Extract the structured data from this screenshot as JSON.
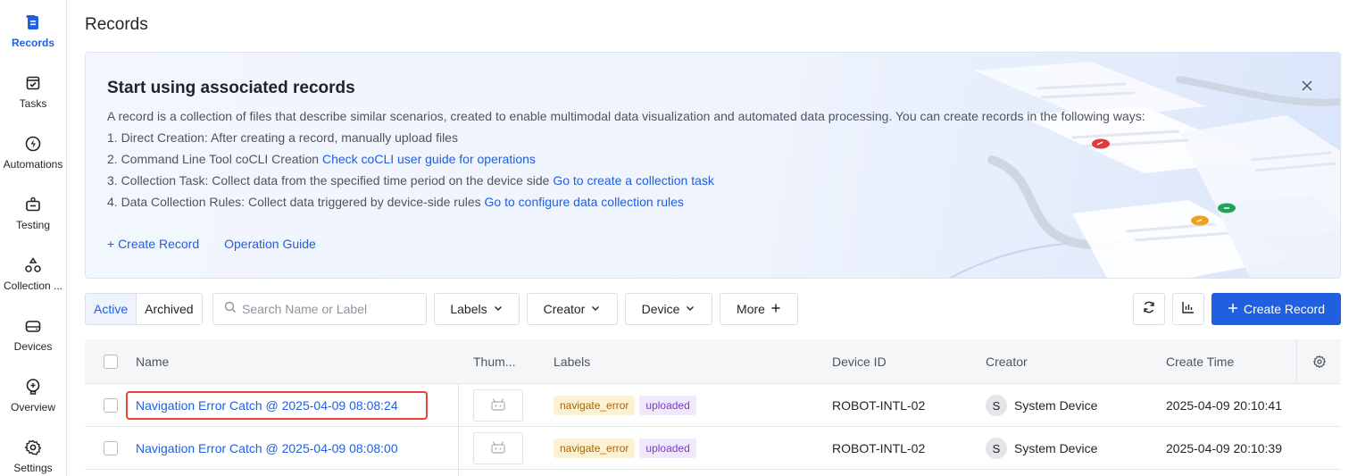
{
  "sidebar": {
    "items": [
      {
        "label": "Records",
        "icon": "records-icon",
        "active": true
      },
      {
        "label": "Tasks",
        "icon": "tasks-icon"
      },
      {
        "label": "Automations",
        "icon": "automations-icon"
      },
      {
        "label": "Testing",
        "icon": "testing-icon"
      },
      {
        "label": "Collection ...",
        "icon": "collection-icon"
      },
      {
        "label": "Devices",
        "icon": "devices-icon"
      },
      {
        "label": "Overview",
        "icon": "overview-icon"
      },
      {
        "label": "Settings",
        "icon": "settings-icon"
      }
    ]
  },
  "page": {
    "title": "Records"
  },
  "banner": {
    "title": "Start using associated records",
    "description": "A record is a collection of files that describe similar scenarios, created to enable multimodal data visualization and automated data processing. You can create records in the following ways:",
    "steps": [
      {
        "text": "1. Direct Creation: After creating a record, manually upload files",
        "link": ""
      },
      {
        "text": "2. Command Line Tool coCLI Creation ",
        "link": "Check coCLI user guide for operations"
      },
      {
        "text": "3. Collection Task: Collect data from the specified time period on the device side ",
        "link": "Go to create a collection task"
      },
      {
        "text": "4. Data Collection Rules: Collect data triggered by device-side rules ",
        "link": "Go to configure data collection rules"
      }
    ],
    "create_label": "+ Create Record",
    "guide_label": "Operation Guide"
  },
  "toolbar": {
    "active_tab": "Active",
    "archived_tab": "Archived",
    "search_placeholder": "Search Name or Label",
    "filters": [
      "Labels",
      "Creator",
      "Device",
      "More"
    ],
    "create_button": "Create Record"
  },
  "table": {
    "columns": [
      "Name",
      "Thum...",
      "Labels",
      "Device ID",
      "Creator",
      "Create Time"
    ],
    "rows": [
      {
        "name": "Navigation Error Catch @ 2025-04-09 08:08:24",
        "labels": [
          "navigate_error",
          "uploaded"
        ],
        "device_id": "ROBOT-INTL-02",
        "creator_initial": "S",
        "creator": "System Device",
        "create_time": "2025-04-09 20:10:41",
        "highlighted": true
      },
      {
        "name": "Navigation Error Catch @ 2025-04-09 08:08:00",
        "labels": [
          "navigate_error",
          "uploaded"
        ],
        "device_id": "ROBOT-INTL-02",
        "creator_initial": "S",
        "creator": "System Device",
        "create_time": "2025-04-09 20:10:39",
        "highlighted": false
      }
    ]
  },
  "colors": {
    "accent": "#1f5fe0",
    "highlight": "#e5443b",
    "tag_warn_bg": "#fdf1d3",
    "tag_purple_bg": "#f1e9fb"
  }
}
